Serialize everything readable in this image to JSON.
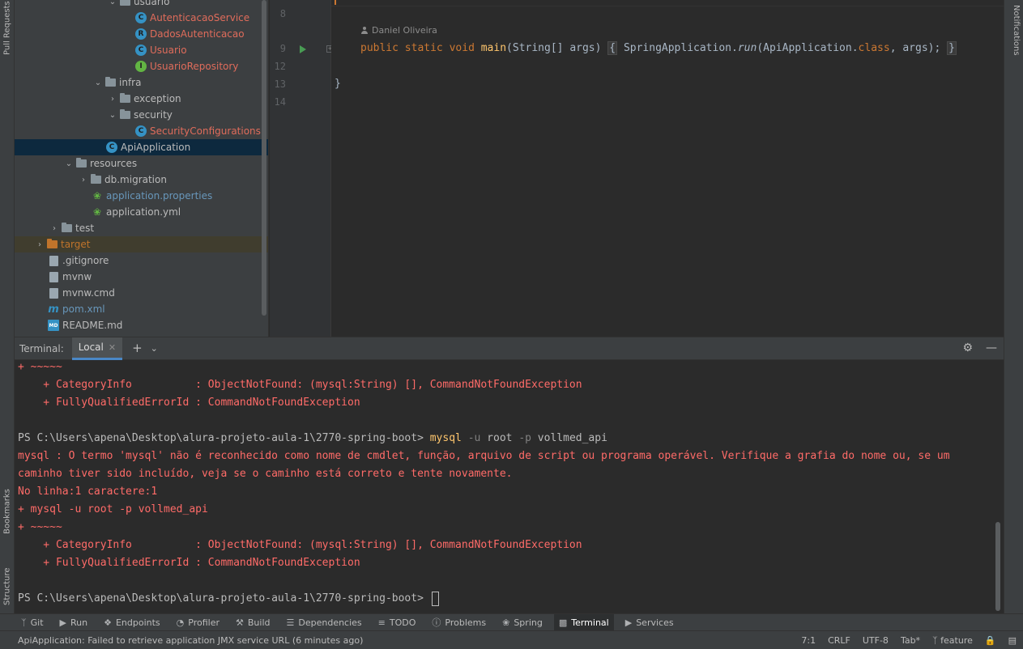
{
  "left_strip": {
    "pull_requests": "Pull Requests",
    "bookmarks": "Bookmarks",
    "structure": "Structure"
  },
  "right_strip": {
    "notifications": "Notifications"
  },
  "tree": {
    "items": [
      {
        "label": "usuario",
        "type": "folder"
      },
      {
        "label": "AutenticacaoService",
        "type": "class"
      },
      {
        "label": "DadosAutenticacao",
        "type": "record"
      },
      {
        "label": "Usuario",
        "type": "class"
      },
      {
        "label": "UsuarioRepository",
        "type": "interface"
      },
      {
        "label": "infra",
        "type": "folder"
      },
      {
        "label": "exception",
        "type": "folder"
      },
      {
        "label": "security",
        "type": "folder"
      },
      {
        "label": "SecurityConfigurations",
        "type": "class"
      },
      {
        "label": "ApiApplication",
        "type": "spring-class"
      },
      {
        "label": "resources",
        "type": "folder"
      },
      {
        "label": "db.migration",
        "type": "folder"
      },
      {
        "label": "application.properties",
        "type": "spring-config"
      },
      {
        "label": "application.yml",
        "type": "spring-config"
      },
      {
        "label": "test",
        "type": "folder"
      },
      {
        "label": "target",
        "type": "folder"
      },
      {
        "label": ".gitignore",
        "type": "file"
      },
      {
        "label": "mvnw",
        "type": "file"
      },
      {
        "label": "mvnw.cmd",
        "type": "file"
      },
      {
        "label": "pom.xml",
        "type": "maven"
      },
      {
        "label": "README.md",
        "type": "markdown"
      }
    ]
  },
  "editor": {
    "line_numbers": [
      "8",
      "9",
      "12",
      "13",
      "14"
    ],
    "author": "Daniel Oliveira",
    "code": {
      "kw1": "public",
      "kw2": "static",
      "kw3": "void",
      "method": "main",
      "params": "(String[] args)",
      "open_brace": "{",
      "call_class": "SpringApplication.",
      "call_method": "run",
      "call_args_a": "(ApiApplication.",
      "call_kw": "class",
      "call_args_b": ", args);",
      "close_brace": "}",
      "class_close": "}"
    }
  },
  "terminal": {
    "title": "Terminal:",
    "tab_label": "Local",
    "lines": [
      {
        "text": "+ ~~~~~",
        "style": "err"
      },
      {
        "text": "    + CategoryInfo          : ObjectNotFound: (mysql:String) [], CommandNotFoundException",
        "style": "err"
      },
      {
        "text": "    + FullyQualifiedErrorId : CommandNotFoundException",
        "style": "err"
      },
      {
        "text": "",
        "style": "norm"
      },
      {
        "prompt": "PS C:\\Users\\apena\\Desktop\\alura-projeto-aula-1\\2770-spring-boot> ",
        "cmd": "mysql",
        "flag1": " -u",
        "arg1": " root",
        "flag2": " -p",
        "arg2": " vollmed_api",
        "style": "prompt"
      },
      {
        "text": "mysql : O termo 'mysql' não é reconhecido como nome de cmdlet, função, arquivo de script ou programa operável. Verifique a grafia do nome ou, se um",
        "style": "err"
      },
      {
        "text": "caminho tiver sido incluído, veja se o caminho está correto e tente novamente.",
        "style": "err"
      },
      {
        "text": "No linha:1 caractere:1",
        "style": "err"
      },
      {
        "text": "+ mysql -u root -p vollmed_api",
        "style": "err"
      },
      {
        "text": "+ ~~~~~",
        "style": "err"
      },
      {
        "text": "    + CategoryInfo          : ObjectNotFound: (mysql:String) [], CommandNotFoundException",
        "style": "err"
      },
      {
        "text": "    + FullyQualifiedErrorId : CommandNotFoundException",
        "style": "err"
      },
      {
        "text": "",
        "style": "norm"
      },
      {
        "text": "PS C:\\Users\\apena\\Desktop\\alura-projeto-aula-1\\2770-spring-boot>",
        "style": "norm"
      }
    ]
  },
  "toolbar": {
    "items": [
      {
        "label": "Git",
        "icon": "branch-icon"
      },
      {
        "label": "Run",
        "icon": "run-icon"
      },
      {
        "label": "Endpoints",
        "icon": "endpoints-icon"
      },
      {
        "label": "Profiler",
        "icon": "profiler-icon"
      },
      {
        "label": "Build",
        "icon": "hammer-icon"
      },
      {
        "label": "Dependencies",
        "icon": "stack-icon"
      },
      {
        "label": "TODO",
        "icon": "list-icon"
      },
      {
        "label": "Problems",
        "icon": "info-icon"
      },
      {
        "label": "Spring",
        "icon": "leaf-icon"
      },
      {
        "label": "Terminal",
        "icon": "terminal-icon"
      },
      {
        "label": "Services",
        "icon": "services-icon"
      }
    ]
  },
  "status": {
    "message": "ApiApplication: Failed to retrieve application JMX service URL (6 minutes ago)",
    "position": "7:1",
    "line_sep": "CRLF",
    "encoding": "UTF-8",
    "indent": "Tab*",
    "branch": "feature"
  }
}
